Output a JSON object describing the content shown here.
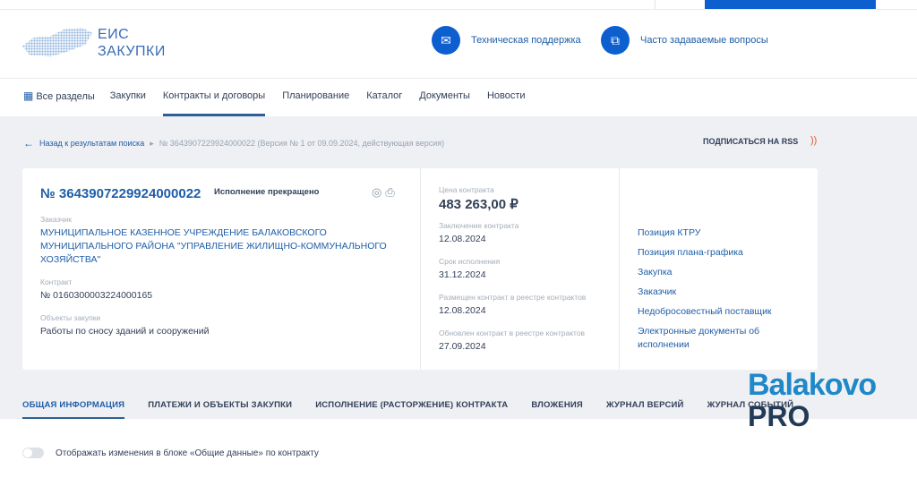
{
  "header": {
    "logo_line1": "ЕИС",
    "logo_line2": "ЗАКУПКИ",
    "support": "Техническая поддержка",
    "faq": "Часто задаваемые вопросы"
  },
  "nav": {
    "items": [
      "Все разделы",
      "Закупки",
      "Контракты и договоры",
      "Планирование",
      "Каталог",
      "Документы",
      "Новости"
    ]
  },
  "breadcrumb": {
    "back": "Назад к результатам поиска",
    "current": "№ 3643907229924000022 (Версия № 1 от 09.09.2024, действующая версия)",
    "rss": "ПОДПИСАТЬСЯ НА RSS"
  },
  "card": {
    "number": "№ 3643907229924000022",
    "status": "Исполнение прекращено",
    "customer_label": "Заказчик",
    "customer": "МУНИЦИПАЛЬНОЕ КАЗЕННОЕ УЧРЕЖДЕНИЕ БАЛАКОВСКОГО МУНИЦИПАЛЬНОГО РАЙОНА \"УПРАВЛЕНИЕ ЖИЛИЩНО-КОММУНАЛЬНОГО ХОЗЯЙСТВА\"",
    "contract_label": "Контракт",
    "contract": "№ 0160300003224000165",
    "objects_label": "Объекты закупки",
    "objects": "Работы по сносу зданий и сооружений",
    "price_label": "Цена контракта",
    "price": "483 263,00 ₽",
    "conclusion_label": "Заключение контракта",
    "conclusion": "12.08.2024",
    "term_label": "Срок исполнения",
    "term": "31.12.2024",
    "placed_label": "Размещен контракт в реестре контрактов",
    "placed": "12.08.2024",
    "updated_label": "Обновлен контракт в реестре контрактов",
    "updated": "27.09.2024",
    "links": [
      "Позиция КТРУ",
      "Позиция плана-графика",
      "Закупка",
      "Заказчик",
      "Недобросовестный поставщик",
      "Электронные документы об исполнении"
    ]
  },
  "tabs": [
    "ОБЩАЯ ИНФОРМАЦИЯ",
    "ПЛАТЕЖИ И ОБЪЕКТЫ ЗАКУПКИ",
    "ИСПОЛНЕНИЕ (РАСТОРЖЕНИЕ) КОНТРАКТА",
    "ВЛОЖЕНИЯ",
    "ЖУРНАЛ ВЕРСИЙ",
    "ЖУРНАЛ СОБЫТИЙ"
  ],
  "toggle_label": "Отображать изменения в блоке «Общие данные» по контракту",
  "watermark": {
    "line1": "Balakovo",
    "line2": "PRO"
  }
}
